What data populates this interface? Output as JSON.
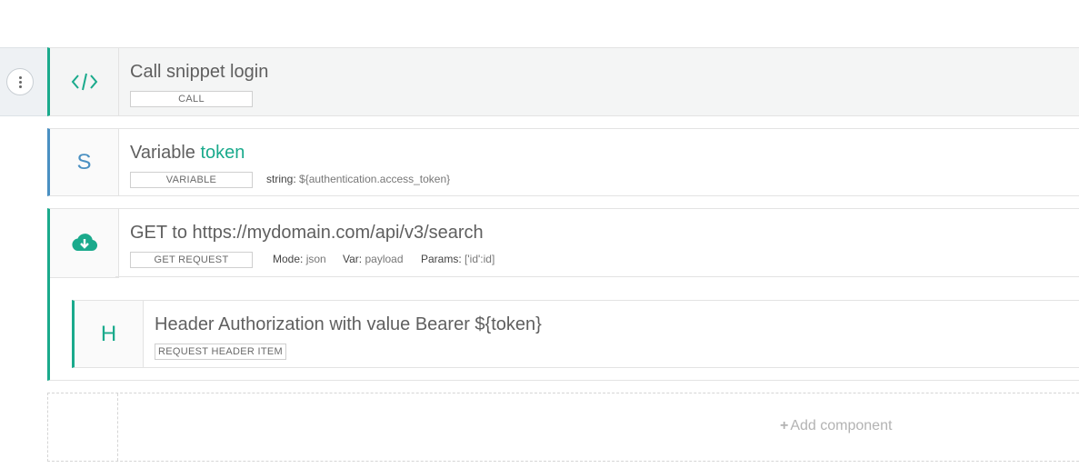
{
  "rows": {
    "call": {
      "title": "Call snippet login",
      "badge": "CALL",
      "icon": "code-icon"
    },
    "variable": {
      "title_prefix": "Variable ",
      "title_name": "token",
      "badge": "VARIABLE",
      "letter": "S",
      "meta_label": "string:",
      "meta_value": "${authentication.access_token}"
    },
    "get": {
      "title": "GET to https://mydomain.com/api/v3/search",
      "badge": "GET REQUEST",
      "icon": "cloud-download-icon",
      "mode_label": "Mode:",
      "mode_value": "json",
      "var_label": "Var:",
      "var_value": "payload",
      "params_label": "Params:",
      "params_value": "['id':id]"
    },
    "header": {
      "title": "Header Authorization with value Bearer ${token}",
      "badge": "REQUEST HEADER ITEM",
      "letter": "H"
    }
  },
  "add": {
    "label": "Add component",
    "icon": "plus-icon"
  },
  "colors": {
    "accent": "#1aaa8c",
    "variable": "#4a90c2"
  }
}
